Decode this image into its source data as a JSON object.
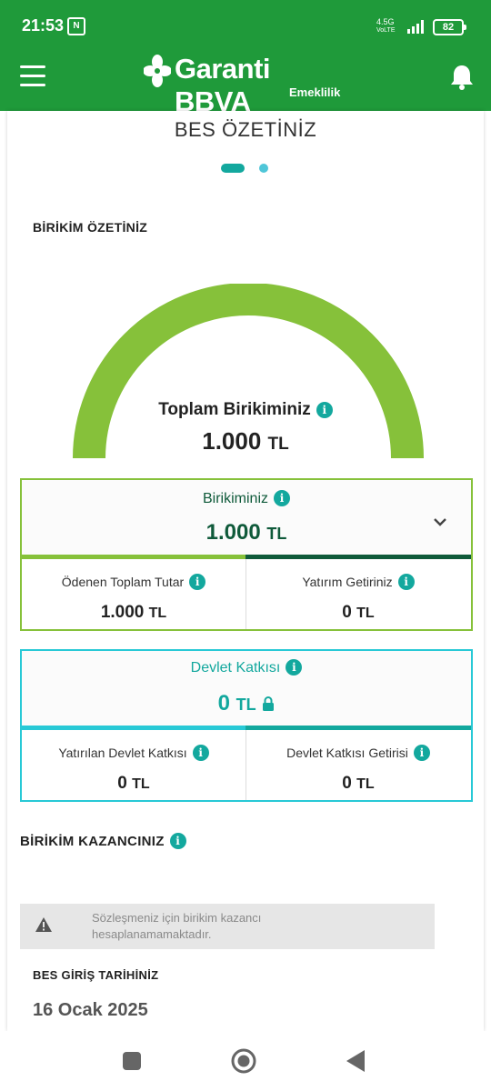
{
  "status_bar": {
    "time": "21:53",
    "nfc_label": "N",
    "network_top": "4.5G",
    "network_bottom": "VoLTE",
    "battery": "82"
  },
  "app_bar": {
    "brand": "Garanti BBVA",
    "sub_brand": "Emeklilik",
    "menu_icon": "hamburger-icon",
    "notification_icon": "bell-icon"
  },
  "page": {
    "title": "BES ÖZETİNİZ",
    "carousel": {
      "active_index": 0,
      "count": 2
    }
  },
  "savings_summary": {
    "label": "BİRİKİM ÖZETİNİZ",
    "gauge_fill": 1.0,
    "total_label": "Toplam Birikiminiz",
    "total_value": "1.000",
    "currency": "TL"
  },
  "savings_card": {
    "label": "Birikiminiz",
    "value": "1.000",
    "currency": "TL",
    "paid_label": "Ödenen Toplam Tutar",
    "paid_value": "1.000",
    "return_label": "Yatırım Getiriniz",
    "return_value": "0"
  },
  "state_contribution_card": {
    "label": "Devlet Katkısı",
    "value": "0",
    "currency": "TL",
    "deposited_label": "Yatırılan Devlet Katkısı",
    "deposited_value": "0",
    "return_label": "Devlet Katkısı Getirisi",
    "return_value": "0"
  },
  "savings_gain": {
    "label": "BİRİKİM KAZANCINIZ",
    "warning_line1": "Sözleşmeniz için birikim kazancı",
    "warning_line2": "hesaplanamamaktadır."
  },
  "entry_date": {
    "label": "BES GİRİŞ TARİHİNİZ",
    "value": "16 Ocak 2025"
  },
  "colors": {
    "brand_green": "#1f9a3a",
    "gauge_green": "#86c13a",
    "dark_green": "#0f5a3a",
    "teal": "#13a89e",
    "cyan": "#28c9d6"
  }
}
